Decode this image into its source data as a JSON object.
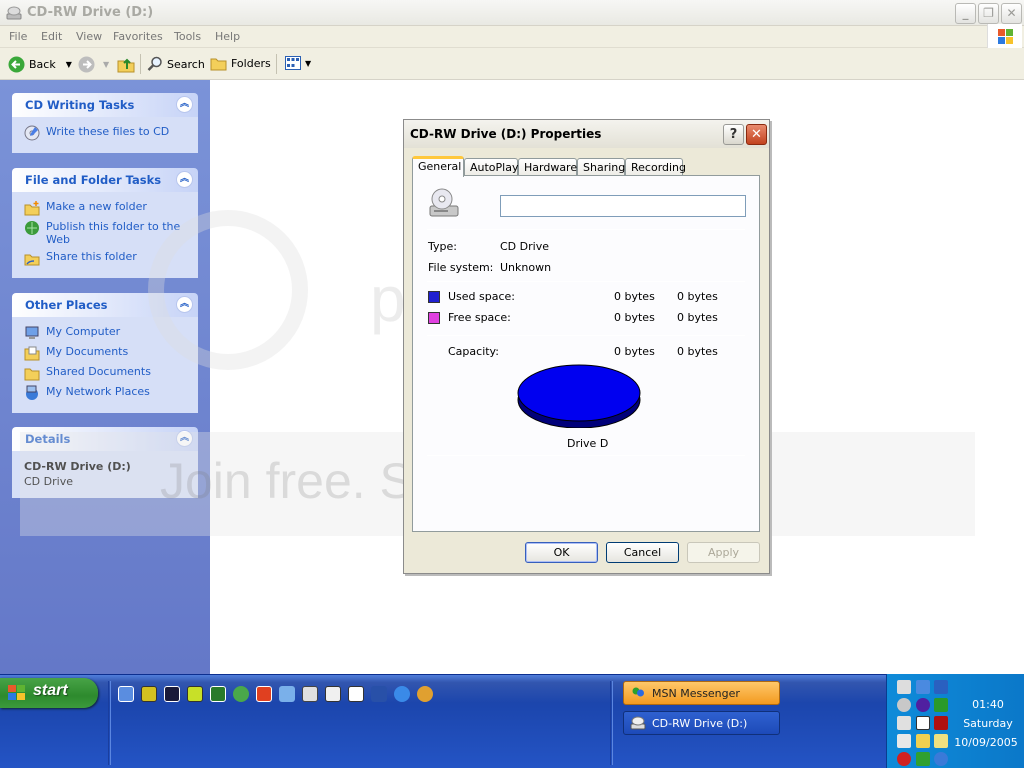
{
  "window": {
    "title": "CD-RW Drive (D:)",
    "min_label": "_",
    "max_label": "❐",
    "close_label": "✕"
  },
  "menu": [
    "File",
    "Edit",
    "View",
    "Favorites",
    "Tools",
    "Help"
  ],
  "toolbar": {
    "back_label": "Back",
    "search_label": "Search",
    "folders_label": "Folders"
  },
  "sidebar": {
    "cd_tasks": {
      "title": "CD Writing Tasks",
      "items": [
        {
          "label": "Write these files to CD",
          "icon": "cd-write-icon"
        }
      ]
    },
    "file_tasks": {
      "title": "File and Folder Tasks",
      "items": [
        {
          "label": "Make a new folder",
          "icon": "new-folder-icon"
        },
        {
          "label": "Publish this folder to the Web",
          "icon": "publish-web-icon"
        },
        {
          "label": "Share this folder",
          "icon": "share-folder-icon"
        }
      ]
    },
    "other_places": {
      "title": "Other Places",
      "items": [
        {
          "label": "My Computer",
          "icon": "my-computer-icon"
        },
        {
          "label": "My Documents",
          "icon": "my-documents-icon"
        },
        {
          "label": "Shared Documents",
          "icon": "shared-documents-icon"
        },
        {
          "label": "My Network Places",
          "icon": "network-places-icon"
        }
      ]
    },
    "details": {
      "title": "Details",
      "name": "CD-RW Drive (D:)",
      "type": "CD Drive"
    }
  },
  "dialog": {
    "title": "CD-RW Drive (D:) Properties",
    "help_label": "?",
    "close_label": "✕",
    "tabs": [
      "General",
      "AutoPlay",
      "Hardware",
      "Sharing",
      "Recording"
    ],
    "active_tab": "General",
    "name_value": "",
    "type_label": "Type:",
    "type_value": "CD Drive",
    "fs_label": "File system:",
    "fs_value": "Unknown",
    "used_label": "Used space:",
    "used_bytes": "0 bytes",
    "used_size": "0 bytes",
    "free_label": "Free space:",
    "free_bytes": "0 bytes",
    "free_size": "0 bytes",
    "capacity_label": "Capacity:",
    "capacity_bytes": "0 bytes",
    "capacity_size": "0 bytes",
    "drive_label": "Drive D",
    "ok_label": "OK",
    "cancel_label": "Cancel",
    "apply_label": "Apply",
    "colors": {
      "used": "#2020d0",
      "free": "#e040e0",
      "pie": "#0000f0"
    }
  },
  "watermark": {
    "line1": "Join free. Share privately.",
    "logo": "photobucket"
  },
  "taskbar": {
    "start_label": "start",
    "tasks": [
      {
        "label": "MSN Messenger",
        "icon": "msn-messenger-icon"
      },
      {
        "label": "CD-RW Drive (D:)",
        "icon": "cd-drive-icon"
      }
    ],
    "clock": {
      "time": "01:40",
      "day": "Saturday",
      "date": "10/09/2005"
    }
  }
}
